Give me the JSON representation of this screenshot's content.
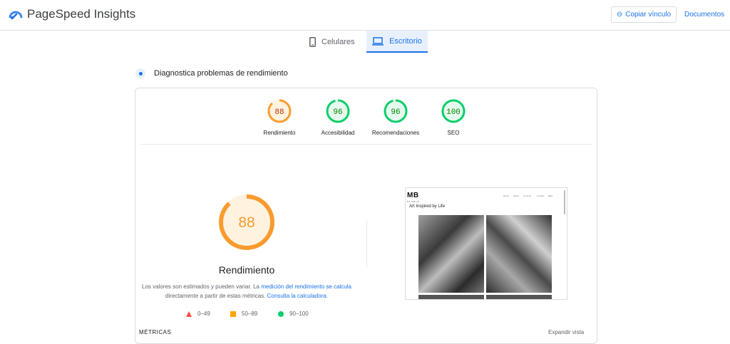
{
  "header": {
    "app_title": "PageSpeed Insights",
    "copy_link_label": "Copiar vínculo",
    "docs_label": "Documentos"
  },
  "tabs": [
    {
      "label": "Celulares",
      "icon": "smartphone-icon",
      "selected": false
    },
    {
      "label": "Escritorio",
      "icon": "laptop-icon",
      "selected": true
    }
  ],
  "diagnostic": {
    "heading": "Diagnostica problemas de rendimiento"
  },
  "scores": [
    {
      "value": "88",
      "label": "Rendimiento",
      "color": "#fa9b2f"
    },
    {
      "value": "96",
      "label": "Accesibilidad",
      "color": "#0cce6b"
    },
    {
      "value": "96",
      "label": "Recomendaciones",
      "color": "#0cce6b"
    },
    {
      "value": "100",
      "label": "SEO",
      "color": "#0cce6b"
    }
  ],
  "main_score": {
    "value": "88",
    "title": "Rendimiento",
    "color": "#fa9b2f",
    "fill_fraction": 0.88
  },
  "description": {
    "part1": "Los valores son estimados y pueden variar. La ",
    "link1": "medición del rendimiento se calcula",
    "part2": " directamente a partir de estas métricas. ",
    "link2": "Consulta la calculadora",
    "part3": "."
  },
  "legend": [
    {
      "range": "0–49",
      "color": "#ff4e42",
      "shape": "triangle"
    },
    {
      "range": "50–89",
      "color": "#ffa400",
      "shape": "square"
    },
    {
      "range": "90–100",
      "color": "#0cce6b",
      "shape": "circle"
    }
  ],
  "metrics": {
    "label": "MÉTRICAS",
    "expand_label": "Expandir vista"
  },
  "screenshot": {
    "logo": "MB",
    "logo_sub": "STUDIO",
    "nav": [
      "Home",
      "About",
      "Courses",
      "Contact",
      "Blog"
    ],
    "heading": "Art Inspired by Life"
  }
}
